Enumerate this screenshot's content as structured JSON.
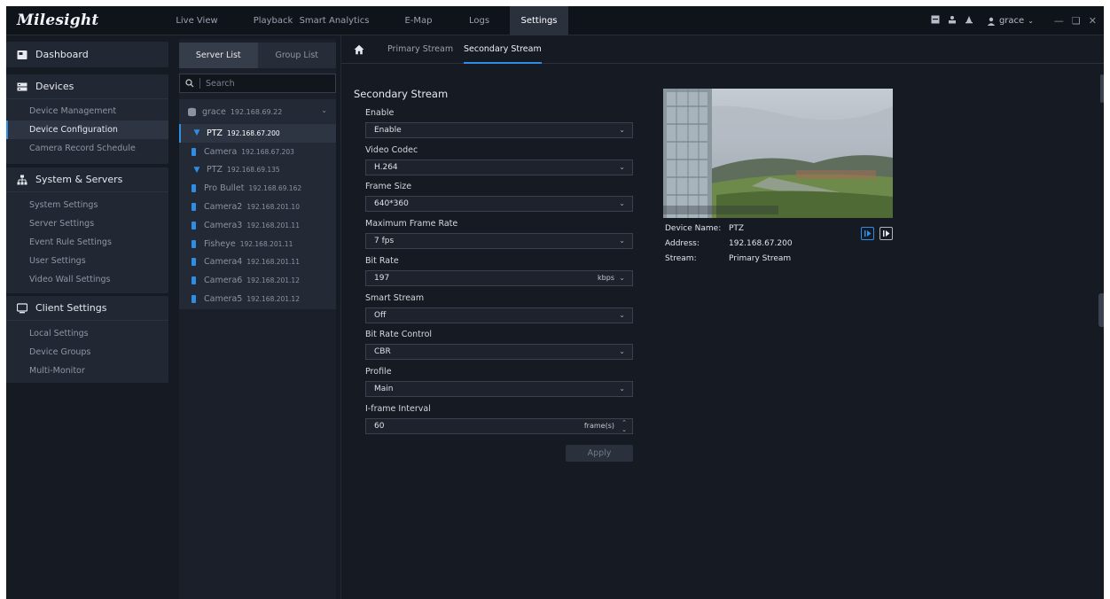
{
  "app": {
    "brand": "Milesight"
  },
  "topnav": {
    "items": [
      {
        "label": "Live View"
      },
      {
        "label": "Playback"
      },
      {
        "label": "Smart Analytics"
      },
      {
        "label": "E-Map"
      },
      {
        "label": "Logs"
      },
      {
        "label": "Settings"
      }
    ],
    "active": "Settings"
  },
  "user": {
    "name": "grace"
  },
  "sidebar": {
    "dashboard": "Dashboard",
    "devices": "Devices",
    "device_items": [
      "Device Management",
      "Device Configuration",
      "Camera Record Schedule"
    ],
    "system": "System & Servers",
    "system_items": [
      "System Settings",
      "Server Settings",
      "Event Rule Settings",
      "User Settings",
      "Video Wall Settings"
    ],
    "client": "Client Settings",
    "client_items": [
      "Local Settings",
      "Device Groups",
      "Multi-Monitor"
    ]
  },
  "device_panel": {
    "tabs": [
      "Server List",
      "Group List"
    ],
    "search_placeholder": "Search",
    "server": {
      "name": "grace",
      "ip": "192.168.69.22"
    },
    "devices": [
      {
        "name": "PTZ",
        "ip": "192.168.67.200",
        "type": "ptz",
        "active": true
      },
      {
        "name": "Camera",
        "ip": "192.168.67.203",
        "type": "camera"
      },
      {
        "name": "PTZ",
        "ip": "192.168.69.135",
        "type": "ptz"
      },
      {
        "name": "Pro Bullet",
        "ip": "192.168.69.162",
        "type": "camera"
      },
      {
        "name": "Camera2",
        "ip": "192.168.201.10",
        "type": "camera"
      },
      {
        "name": "Camera3",
        "ip": "192.168.201.11",
        "type": "camera"
      },
      {
        "name": "Fisheye",
        "ip": "192.168.201.11",
        "type": "camera"
      },
      {
        "name": "Camera4",
        "ip": "192.168.201.11",
        "type": "camera"
      },
      {
        "name": "Camera6",
        "ip": "192.168.201.12",
        "type": "camera"
      },
      {
        "name": "Camera5",
        "ip": "192.168.201.12",
        "type": "camera"
      }
    ]
  },
  "stream_tabs": [
    "Primary Stream",
    "Secondary Stream"
  ],
  "form": {
    "title": "Secondary Stream",
    "fields": [
      {
        "label": "Enable",
        "value": "Enable"
      },
      {
        "label": "Video Codec",
        "value": "H.264"
      },
      {
        "label": "Frame Size",
        "value": "640*360"
      },
      {
        "label": "Maximum Frame Rate",
        "value": "7 fps"
      },
      {
        "label": "Bit Rate",
        "value": "197",
        "unit": "kbps"
      },
      {
        "label": "Smart Stream",
        "value": "Off"
      },
      {
        "label": "Bit Rate Control",
        "value": "CBR"
      },
      {
        "label": "Profile",
        "value": "Main"
      },
      {
        "label": "I-frame Interval",
        "value": "60",
        "unit": "frame(s)"
      }
    ],
    "apply": "Apply"
  },
  "preview": {
    "device_name_label": "Device Name:",
    "device_name": "PTZ",
    "address_label": "Address:",
    "address": "192.168.67.200",
    "stream_label": "Stream:",
    "stream": "Primary Stream"
  },
  "colors": {
    "accent": "#2f8de4",
    "background": "#151a23",
    "panel": "#212733"
  }
}
